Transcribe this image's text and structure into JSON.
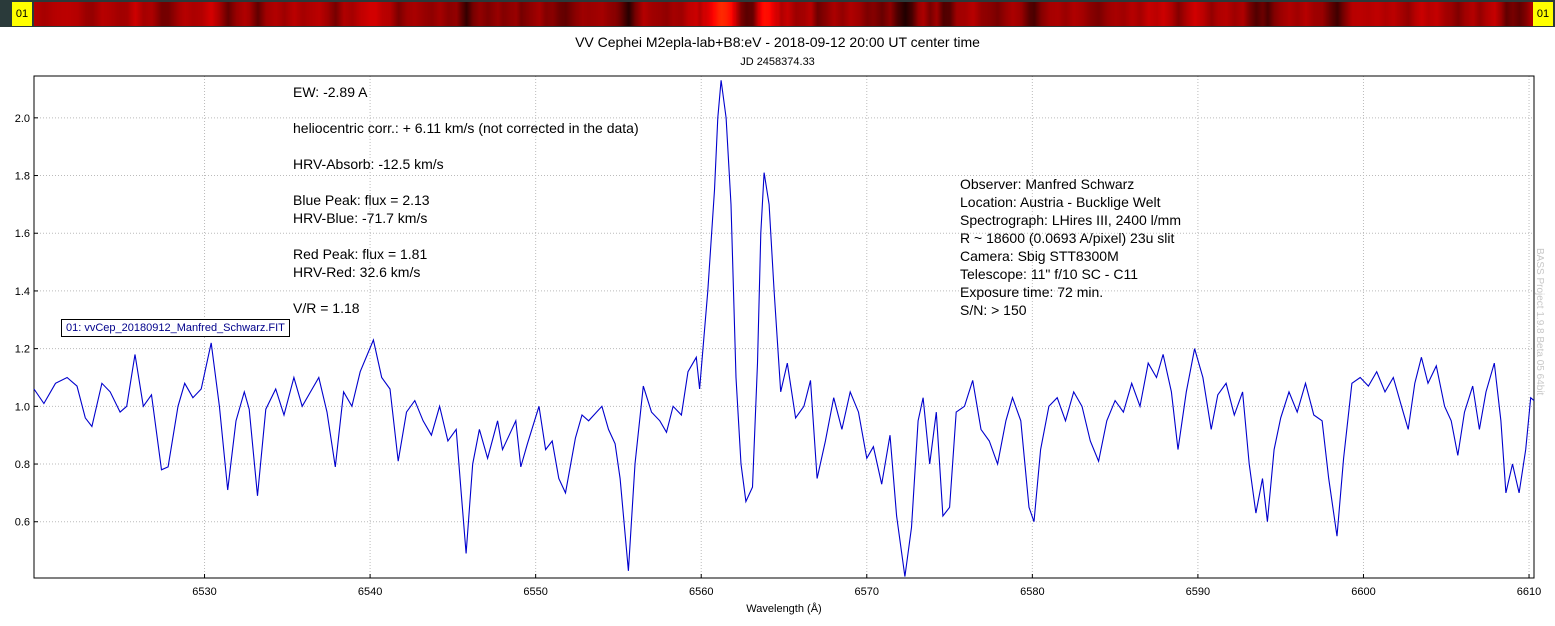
{
  "header": {
    "badge_left": "01",
    "badge_right": "01"
  },
  "chart_data": {
    "type": "line",
    "title": "VV Cephei M2epla-lab+B8:eV - 2018-09-12 20:00 UT center time",
    "subtitle": "JD 2458374.33",
    "xlabel": "Wavelength (Å)",
    "ylabel": "",
    "xlim": [
      6519.7,
      6610.3
    ],
    "ylim": [
      0.405,
      2.145
    ],
    "grid": true,
    "line_color": "#0000cd",
    "x_ticks": [
      "6530",
      "6540",
      "6550",
      "6560",
      "6570",
      "6580",
      "6590",
      "6600",
      "6610"
    ],
    "y_ticks": [
      "0.6",
      "0.8",
      "1.0",
      "1.2",
      "1.4",
      "1.6",
      "1.8",
      "2.0"
    ],
    "series": [
      {
        "name": "01: vvCep_20180912_Manfred_Schwarz.FIT",
        "points": [
          [
            6519.7,
            1.06
          ],
          [
            6520.3,
            1.01
          ],
          [
            6521.0,
            1.08
          ],
          [
            6521.7,
            1.1
          ],
          [
            6522.3,
            1.07
          ],
          [
            6522.8,
            0.96
          ],
          [
            6523.2,
            0.93
          ],
          [
            6523.8,
            1.08
          ],
          [
            6524.3,
            1.05
          ],
          [
            6524.9,
            0.98
          ],
          [
            6525.3,
            1.0
          ],
          [
            6525.8,
            1.18
          ],
          [
            6526.3,
            1.0
          ],
          [
            6526.8,
            1.04
          ],
          [
            6527.4,
            0.78
          ],
          [
            6527.8,
            0.79
          ],
          [
            6528.4,
            1.0
          ],
          [
            6528.8,
            1.08
          ],
          [
            6529.3,
            1.03
          ],
          [
            6529.8,
            1.06
          ],
          [
            6530.4,
            1.22
          ],
          [
            6530.9,
            1.0
          ],
          [
            6531.4,
            0.71
          ],
          [
            6531.9,
            0.95
          ],
          [
            6532.4,
            1.05
          ],
          [
            6532.7,
            0.99
          ],
          [
            6533.2,
            0.69
          ],
          [
            6533.7,
            0.99
          ],
          [
            6534.3,
            1.06
          ],
          [
            6534.8,
            0.97
          ],
          [
            6535.4,
            1.1
          ],
          [
            6535.9,
            1.0
          ],
          [
            6536.4,
            1.05
          ],
          [
            6536.9,
            1.1
          ],
          [
            6537.4,
            0.98
          ],
          [
            6537.9,
            0.79
          ],
          [
            6538.4,
            1.05
          ],
          [
            6538.9,
            1.0
          ],
          [
            6539.4,
            1.12
          ],
          [
            6540.2,
            1.23
          ],
          [
            6540.7,
            1.1
          ],
          [
            6541.2,
            1.06
          ],
          [
            6541.7,
            0.81
          ],
          [
            6542.2,
            0.98
          ],
          [
            6542.7,
            1.02
          ],
          [
            6543.2,
            0.95
          ],
          [
            6543.7,
            0.9
          ],
          [
            6544.2,
            1.0
          ],
          [
            6544.7,
            0.88
          ],
          [
            6545.2,
            0.92
          ],
          [
            6545.5,
            0.7
          ],
          [
            6545.8,
            0.49
          ],
          [
            6546.2,
            0.8
          ],
          [
            6546.6,
            0.92
          ],
          [
            6547.1,
            0.82
          ],
          [
            6547.7,
            0.95
          ],
          [
            6548.0,
            0.85
          ],
          [
            6548.4,
            0.9
          ],
          [
            6548.8,
            0.95
          ],
          [
            6549.1,
            0.79
          ],
          [
            6549.5,
            0.87
          ],
          [
            6550.2,
            1.0
          ],
          [
            6550.6,
            0.85
          ],
          [
            6551.0,
            0.88
          ],
          [
            6551.4,
            0.75
          ],
          [
            6551.8,
            0.7
          ],
          [
            6552.4,
            0.89
          ],
          [
            6552.8,
            0.97
          ],
          [
            6553.2,
            0.95
          ],
          [
            6554.0,
            1.0
          ],
          [
            6554.4,
            0.92
          ],
          [
            6554.8,
            0.87
          ],
          [
            6555.1,
            0.75
          ],
          [
            6555.6,
            0.43
          ],
          [
            6556.0,
            0.8
          ],
          [
            6556.5,
            1.07
          ],
          [
            6557.0,
            0.98
          ],
          [
            6557.5,
            0.95
          ],
          [
            6557.9,
            0.91
          ],
          [
            6558.3,
            1.0
          ],
          [
            6558.8,
            0.97
          ],
          [
            6559.2,
            1.12
          ],
          [
            6559.7,
            1.17
          ],
          [
            6559.9,
            1.06
          ],
          [
            6560.4,
            1.4
          ],
          [
            6560.8,
            1.75
          ],
          [
            6561.0,
            2.0
          ],
          [
            6561.2,
            2.13
          ],
          [
            6561.5,
            2.0
          ],
          [
            6561.8,
            1.7
          ],
          [
            6562.1,
            1.1
          ],
          [
            6562.4,
            0.8
          ],
          [
            6562.7,
            0.67
          ],
          [
            6563.1,
            0.72
          ],
          [
            6563.4,
            1.15
          ],
          [
            6563.6,
            1.6
          ],
          [
            6563.8,
            1.81
          ],
          [
            6564.1,
            1.7
          ],
          [
            6564.4,
            1.4
          ],
          [
            6564.8,
            1.05
          ],
          [
            6565.2,
            1.15
          ],
          [
            6565.7,
            0.96
          ],
          [
            6566.2,
            1.0
          ],
          [
            6566.6,
            1.09
          ],
          [
            6567.0,
            0.75
          ],
          [
            6567.5,
            0.88
          ],
          [
            6568.0,
            1.03
          ],
          [
            6568.5,
            0.92
          ],
          [
            6569.0,
            1.05
          ],
          [
            6569.5,
            0.98
          ],
          [
            6570.0,
            0.82
          ],
          [
            6570.4,
            0.86
          ],
          [
            6570.9,
            0.73
          ],
          [
            6571.4,
            0.9
          ],
          [
            6571.8,
            0.62
          ],
          [
            6572.3,
            0.41
          ],
          [
            6572.7,
            0.58
          ],
          [
            6573.1,
            0.95
          ],
          [
            6573.4,
            1.03
          ],
          [
            6573.8,
            0.8
          ],
          [
            6574.2,
            0.98
          ],
          [
            6574.6,
            0.62
          ],
          [
            6575.0,
            0.65
          ],
          [
            6575.4,
            0.98
          ],
          [
            6575.9,
            1.0
          ],
          [
            6576.4,
            1.09
          ],
          [
            6576.9,
            0.92
          ],
          [
            6577.4,
            0.88
          ],
          [
            6577.9,
            0.8
          ],
          [
            6578.4,
            0.95
          ],
          [
            6578.8,
            1.03
          ],
          [
            6579.3,
            0.95
          ],
          [
            6579.8,
            0.65
          ],
          [
            6580.1,
            0.6
          ],
          [
            6580.5,
            0.85
          ],
          [
            6581.0,
            1.0
          ],
          [
            6581.5,
            1.03
          ],
          [
            6582.0,
            0.95
          ],
          [
            6582.5,
            1.05
          ],
          [
            6583.0,
            1.0
          ],
          [
            6583.5,
            0.88
          ],
          [
            6584.0,
            0.81
          ],
          [
            6584.5,
            0.95
          ],
          [
            6585.0,
            1.02
          ],
          [
            6585.5,
            0.98
          ],
          [
            6586.0,
            1.08
          ],
          [
            6586.5,
            1.0
          ],
          [
            6587.0,
            1.15
          ],
          [
            6587.5,
            1.1
          ],
          [
            6587.9,
            1.18
          ],
          [
            6588.4,
            1.05
          ],
          [
            6588.8,
            0.85
          ],
          [
            6589.3,
            1.05
          ],
          [
            6589.8,
            1.2
          ],
          [
            6590.3,
            1.1
          ],
          [
            6590.8,
            0.92
          ],
          [
            6591.2,
            1.04
          ],
          [
            6591.7,
            1.08
          ],
          [
            6592.2,
            0.97
          ],
          [
            6592.7,
            1.05
          ],
          [
            6593.1,
            0.8
          ],
          [
            6593.5,
            0.63
          ],
          [
            6593.9,
            0.75
          ],
          [
            6594.2,
            0.6
          ],
          [
            6594.6,
            0.85
          ],
          [
            6595.0,
            0.96
          ],
          [
            6595.5,
            1.05
          ],
          [
            6596.0,
            0.98
          ],
          [
            6596.5,
            1.08
          ],
          [
            6597.0,
            0.97
          ],
          [
            6597.5,
            0.95
          ],
          [
            6597.9,
            0.75
          ],
          [
            6598.4,
            0.55
          ],
          [
            6598.8,
            0.82
          ],
          [
            6599.3,
            1.08
          ],
          [
            6599.8,
            1.1
          ],
          [
            6600.3,
            1.07
          ],
          [
            6600.8,
            1.12
          ],
          [
            6601.3,
            1.05
          ],
          [
            6601.8,
            1.1
          ],
          [
            6602.3,
            1.0
          ],
          [
            6602.7,
            0.92
          ],
          [
            6603.1,
            1.08
          ],
          [
            6603.5,
            1.17
          ],
          [
            6603.9,
            1.08
          ],
          [
            6604.4,
            1.14
          ],
          [
            6604.9,
            1.0
          ],
          [
            6605.3,
            0.95
          ],
          [
            6605.7,
            0.83
          ],
          [
            6606.1,
            0.98
          ],
          [
            6606.6,
            1.07
          ],
          [
            6607.0,
            0.92
          ],
          [
            6607.4,
            1.05
          ],
          [
            6607.9,
            1.15
          ],
          [
            6608.3,
            0.95
          ],
          [
            6608.6,
            0.7
          ],
          [
            6609.0,
            0.8
          ],
          [
            6609.4,
            0.7
          ],
          [
            6609.8,
            0.85
          ],
          [
            6610.1,
            1.03
          ],
          [
            6610.3,
            1.02
          ]
        ]
      }
    ],
    "annotations_left": [
      "EW: -2.89 A",
      "heliocentric corr.: + 6.11 km/s (not corrected in the data)",
      "HRV-Absorb: -12.5 km/s",
      "Blue Peak:  flux = 2.13",
      "HRV-Blue: -71.7 km/s",
      "Red Peak:  flux = 1.81",
      "HRV-Red: 32.6 km/s",
      "V/R = 1.18"
    ],
    "annotations_right": [
      "Observer: Manfred Schwarz",
      "Location: Austria - Bucklige Welt",
      "Spectrograph: LHires III, 2400 l/mm",
      "R ~ 18600 (0.0693 A/pixel) 23u slit",
      "Camera: Sbig STT8300M",
      "Telescope: 11\" f/10 SC - C11",
      "Exposure time: 72 min.",
      "S/N:  > 150"
    ],
    "watermark": "BASS Project 1.9.8 Beta 05 64bit"
  }
}
